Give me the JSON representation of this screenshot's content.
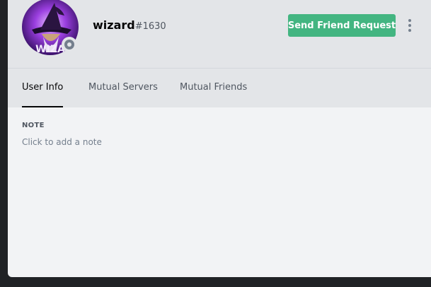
{
  "user": {
    "name": "wizard",
    "discriminator": "#1630",
    "avatar_text": "WIZA",
    "status": "offline"
  },
  "actions": {
    "friend_request_label": "Send Friend Request"
  },
  "tabs": [
    {
      "label": "User Info",
      "active": true
    },
    {
      "label": "Mutual Servers",
      "active": false
    },
    {
      "label": "Mutual Friends",
      "active": false
    }
  ],
  "note": {
    "label": "NOTE",
    "placeholder": "Click to add a note"
  },
  "colors": {
    "accent_green": "#43b581",
    "status_offline": "#747f8d",
    "background": "#202225",
    "panel": "#f2f3f5",
    "header": "#e3e5e8"
  }
}
